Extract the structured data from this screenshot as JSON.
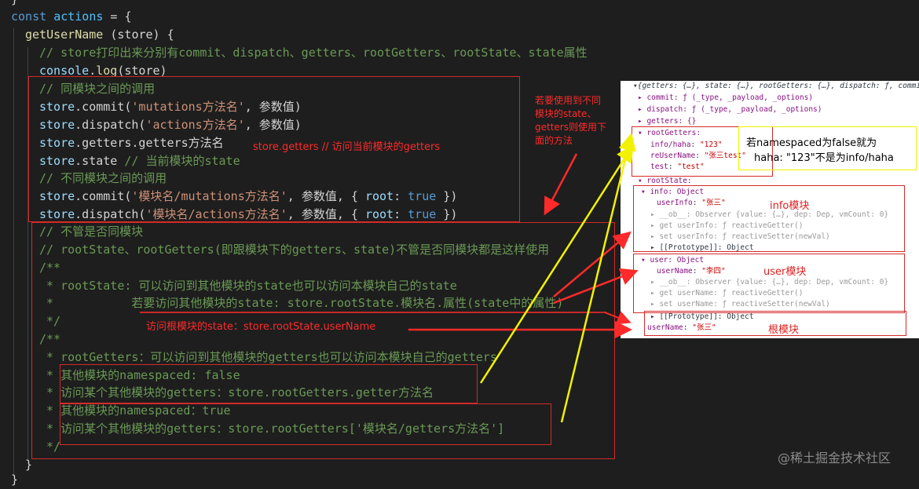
{
  "code": {
    "l0": "}",
    "l1_kw": "const ",
    "l1_var": "actions",
    "l1_rest": " = {",
    "l2_fn": "getUserName",
    "l2_rest": " (store) {",
    "l3": "// store打印出来分别有commit、dispatch、getters、rootGetters、rootState、state属性",
    "l4_a": "console",
    "l4_b": ".",
    "l4_c": "log",
    "l4_d": "(store)",
    "l5": "// 同模块之间的调用",
    "l6_a": "store",
    "l6_b": ".commit(",
    "l6_c": "'mutations方法名'",
    "l6_d": ", 参数值)",
    "l7_a": "store",
    "l7_b": ".dispatch(",
    "l7_c": "'actions方法名'",
    "l7_d": ", 参数值)",
    "l8_a": "store",
    "l8_b": ".getters.getters方法名",
    "l9_a": "store",
    "l9_b": ".state ",
    "l9_c": "// 当前模块的state",
    "l10": "// 不同模块之间的调用",
    "l11_a": "store",
    "l11_b": ".commit(",
    "l11_c": "'模块名/mutations方法名'",
    "l11_d": ", 参数值, { ",
    "l11_e": "root",
    "l11_f": ": ",
    "l11_g": "true",
    "l11_h": " })",
    "l12_a": "store",
    "l12_b": ".dispatch(",
    "l12_c": "'模块名/actions方法名'",
    "l12_d": ", 参数值, { ",
    "l12_e": "root",
    "l12_f": ": ",
    "l12_g": "true",
    "l12_h": " })",
    "l13": "// 不管是否同模块",
    "l14": "// rootState、rootGetters(即跟模块下的getters、state)不管是否同模块都是这样使用",
    "l15": "/**",
    "l16": " * rootState: 可以访问到其他模块的state也可以访问本模块自己的state",
    "l17": " *           若要访问其他模块的state: store.rootState.模块名.属性(state中的属性)",
    "l18": " */",
    "l19": "/**",
    "l20": " * rootGetters：可以访问到其他模块的getters也可以访问本模块自己的getters",
    "l21": " * 其他模块的namespaced: false",
    "l22": " * 访问某个其他模块的getters：store.rootGetters.getter方法名",
    "l23": " * 其他模块的namespaced：true",
    "l24": " * 访问某个其他模块的getters：store.rootGetters['模块名/getters方法名']",
    "l25": " */",
    "l26": "}",
    "l27": "}"
  },
  "annotations": {
    "getters_note": "store.getters // 访问当前模块的getters",
    "cross_module_note": "若要使用到不同\n模块的state、\ngetters则使用下\n面的方法",
    "root_state_note": "访问根模块的state：store.rootState.userName"
  },
  "console": {
    "line1": "▾{getters: {…}, state: {…}, rootGetters: {…}, dispatch: ƒ, commit: ƒ, …}",
    "line2": "▸ commit: ƒ (_type, _payload, _options)",
    "line3": "▸ dispatch: ƒ (_type, _payload, _options)",
    "line4": "▸ getters: {}",
    "rg_label": "▾ rootGetters:",
    "rg_1_key": "info/haha",
    "rg_1_val": "\"123\"",
    "rg_2_key": "reUserName",
    "rg_2_val": "\"张三test\"",
    "rg_3_key": "test",
    "rg_3_val": "\"test\"",
    "rs_label": "▾ rootState:",
    "info_label": "▾ info: Object",
    "info_user_key": "userInfo",
    "info_user_val": "\"张三\"",
    "info_ob": "▸ __ob__: Observer {value: {…}, dep: Dep, vmCount: 0}",
    "info_get": "▸ get userInfo: ƒ reactiveGetter()",
    "info_set": "▸ set userInfo: ƒ reactiveSetter(newVal)",
    "info_proto": "▸ [[Prototype]]: Object",
    "user_label": "▾ user: Object",
    "user_name_key": "userName",
    "user_name_val": "\"李四\"",
    "user_ob": "▸ __ob__: Observer {value: {…}, dep: Dep, vmCount: 0}",
    "user_get": "▸ get userName: ƒ reactiveGetter()",
    "user_set": "▸ set userName: ƒ reactiveSetter(newVal)",
    "root_proto": "▸ [[Prototype]]: Object",
    "root_name_key": "userName",
    "root_name_val": "\"张三\"",
    "ns_note_1": "若namespaced为false就为",
    "ns_note_2": "haha: \"123\"不是为info/haha",
    "info_module": "info模块",
    "user_module": "user模块",
    "root_module": "根模块"
  },
  "watermark": "@稀土掘金技术社区",
  "colors": {
    "annotation_red": "#ff2a2a",
    "annotation_yellow": "#f2f200",
    "editor_bg": "#1e1e1e"
  }
}
